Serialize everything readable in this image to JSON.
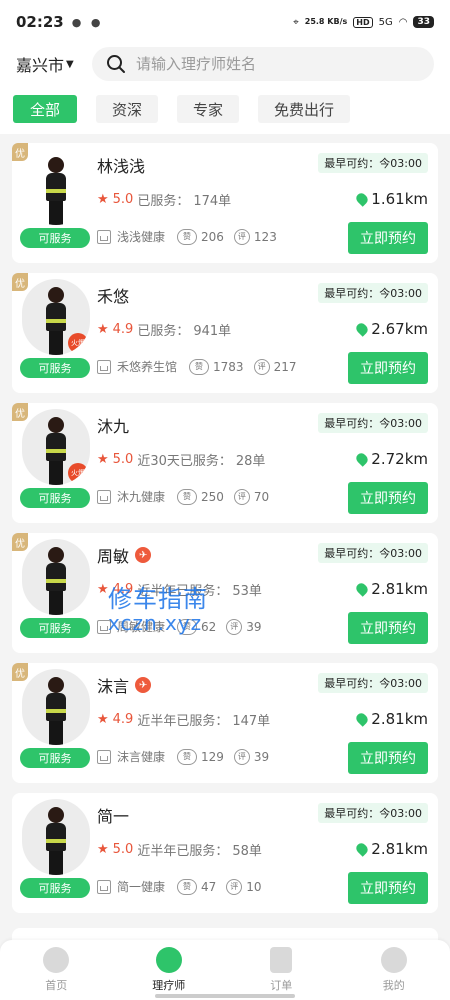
{
  "status": {
    "time": "02:23",
    "net_speed": "25.8 KB/s",
    "hd": "HD",
    "signal": "5G",
    "battery": "33"
  },
  "header": {
    "city": "嘉兴市",
    "search_placeholder": "请输入理疗师姓名"
  },
  "tabs": [
    {
      "label": "全部",
      "active": true
    },
    {
      "label": "资深",
      "active": false
    },
    {
      "label": "专家",
      "active": false
    },
    {
      "label": "免费出行",
      "active": false
    }
  ],
  "labels": {
    "status": "可服务",
    "book": "立即预约",
    "badge": "优",
    "avail_prefix": "最早可约：",
    "hot": "火爆"
  },
  "therapists": [
    {
      "name": "林浅浅",
      "rating": "5.0",
      "service_label": "已服务：",
      "orders": "174单",
      "shop": "浅浅健康",
      "likes": "206",
      "reviews": "123",
      "avail": "今03:00",
      "distance": "1.61km",
      "badge": true,
      "hot": false
    },
    {
      "name": "禾悠",
      "rating": "4.9",
      "service_label": "已服务：",
      "orders": "941单",
      "shop": "禾悠养生馆",
      "likes": "1783",
      "reviews": "217",
      "avail": "今03:00",
      "distance": "2.67km",
      "badge": true,
      "hot": true
    },
    {
      "name": "沐九",
      "rating": "5.0",
      "service_label": "近30天已服务：",
      "orders": "28单",
      "shop": "沐九健康",
      "likes": "250",
      "reviews": "70",
      "avail": "今03:00",
      "distance": "2.72km",
      "badge": true,
      "hot": true
    },
    {
      "name": "周敏",
      "rating": "4.9",
      "service_label": "近半年已服务：",
      "orders": "53单",
      "shop": "周敏健康",
      "likes": "62",
      "reviews": "39",
      "avail": "今03:00",
      "distance": "2.81km",
      "badge": true,
      "hot": false
    },
    {
      "name": "沫言",
      "rating": "4.9",
      "service_label": "近半年已服务：",
      "orders": "147单",
      "shop": "沫言健康",
      "likes": "129",
      "reviews": "39",
      "avail": "今03:00",
      "distance": "2.81km",
      "badge": true,
      "hot": false
    },
    {
      "name": "简一",
      "rating": "5.0",
      "service_label": "近半年已服务：",
      "orders": "58单",
      "shop": "简一健康",
      "likes": "47",
      "reviews": "10",
      "avail": "今03:00",
      "distance": "2.81km",
      "badge": false,
      "hot": false
    }
  ],
  "watermark": {
    "line1": "修车指南",
    "line2": "xczn.xyz"
  },
  "nav": [
    {
      "label": "首页",
      "icon": "home-icon",
      "active": false
    },
    {
      "label": "理疗师",
      "icon": "therapist-icon",
      "active": true
    },
    {
      "label": "订单",
      "icon": "order-icon",
      "active": false
    },
    {
      "label": "我的",
      "icon": "profile-icon",
      "active": false
    }
  ],
  "colors": {
    "accent": "#2ec46a",
    "rating": "#e8553a",
    "badge": "#d8b67a"
  }
}
